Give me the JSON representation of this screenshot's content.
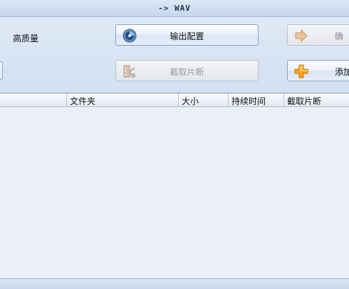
{
  "window": {
    "title": "-> WAV"
  },
  "settings": {
    "quality_label": "高质量",
    "output_config_label": "输出配置",
    "clip_label": "截取片断",
    "confirm_label": "确",
    "add_label": "添加"
  },
  "file_table": {
    "columns": [
      "文件夹",
      "大小",
      "持续时间",
      "截取片断"
    ],
    "rows": []
  },
  "colors": {
    "accent": "#cfdcee",
    "header_border": "#7f97bb",
    "disabled_text": "#9a9a9a"
  },
  "icons": {
    "output_config": "gear-disc-icon",
    "clip": "film-clip-icon",
    "confirm": "arrow-right-icon",
    "add": "plus-icon"
  }
}
